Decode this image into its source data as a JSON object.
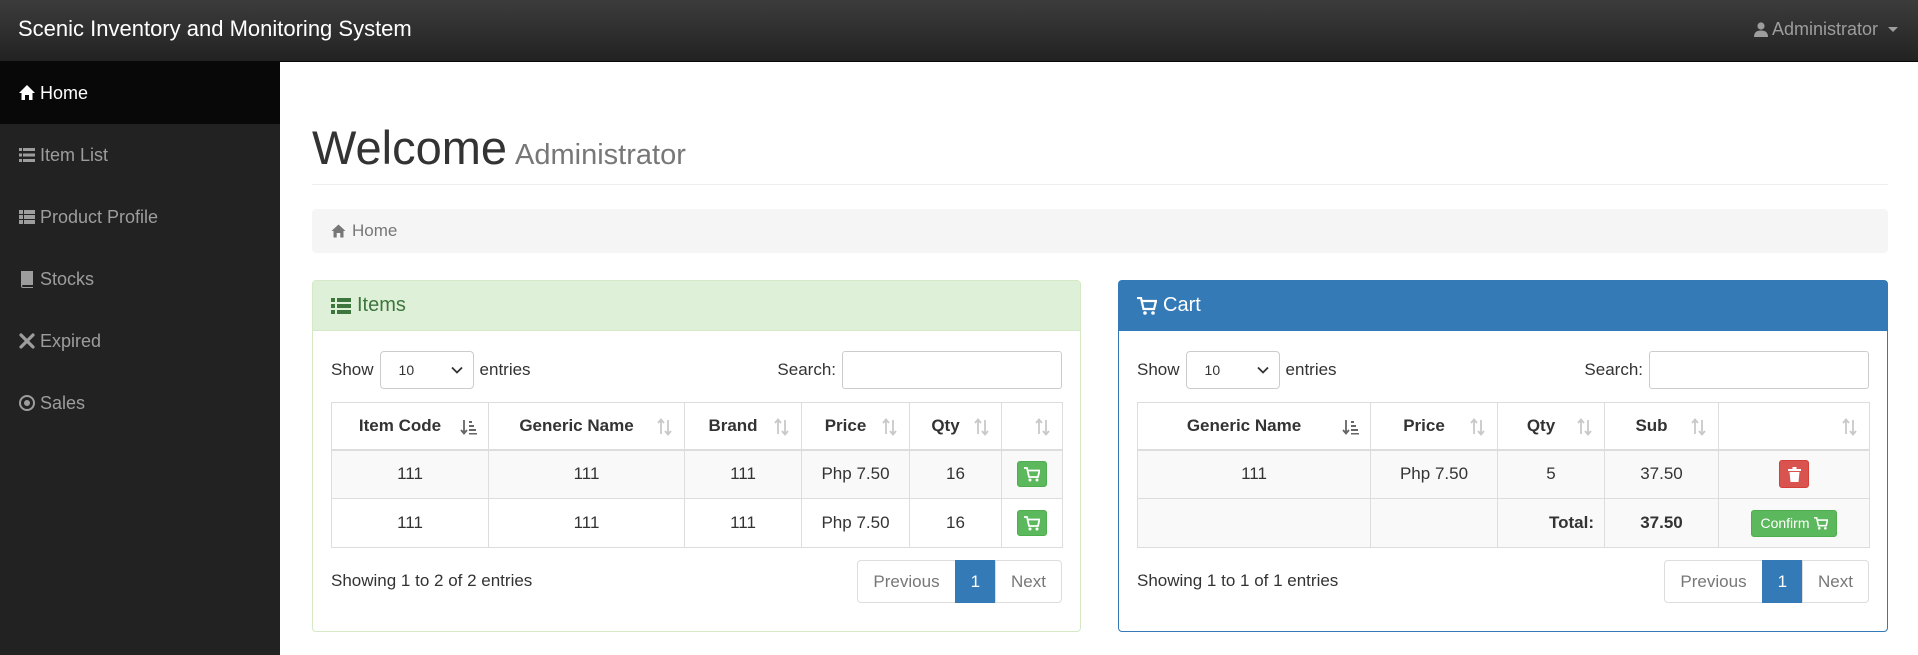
{
  "navbar": {
    "brand": "Scenic Inventory and Monitoring System",
    "user": "Administrator",
    "user_icon": "user-icon"
  },
  "sidebar": {
    "items": [
      {
        "label": "Home",
        "icon": "home-icon",
        "active": true
      },
      {
        "label": "Item List",
        "icon": "list-icon"
      },
      {
        "label": "Product Profile",
        "icon": "grid-list-icon"
      },
      {
        "label": "Stocks",
        "icon": "book-icon"
      },
      {
        "label": "Expired",
        "icon": "x-icon"
      },
      {
        "label": "Sales",
        "icon": "target-icon"
      }
    ]
  },
  "header": {
    "title": "Welcome",
    "subtitle": "Administrator"
  },
  "breadcrumb": {
    "label": "Home"
  },
  "items_panel": {
    "title": "Items",
    "show_label": "Show",
    "entries_label": "entries",
    "length_value": "10",
    "search_label": "Search:",
    "columns": [
      "Item Code",
      "Generic Name",
      "Brand",
      "Price",
      "Qty",
      ""
    ],
    "rows": [
      {
        "item_code": "111",
        "generic_name": "111",
        "brand": "111",
        "price": "Php 7.50",
        "qty": "16"
      },
      {
        "item_code": "111",
        "generic_name": "111",
        "brand": "111",
        "price": "Php 7.50",
        "qty": "16"
      }
    ],
    "info": "Showing 1 to 2 of 2 entries",
    "pager": {
      "previous": "Previous",
      "current": "1",
      "next": "Next"
    }
  },
  "cart_panel": {
    "title": "Cart",
    "show_label": "Show",
    "entries_label": "entries",
    "length_value": "10",
    "search_label": "Search:",
    "columns": [
      "Generic Name",
      "Price",
      "Qty",
      "Sub",
      ""
    ],
    "rows": [
      {
        "generic_name": "111",
        "price": "Php 7.50",
        "qty": "5",
        "sub": "37.50"
      }
    ],
    "total_label": "Total:",
    "total_value": "37.50",
    "confirm_label": "Confirm",
    "info": "Showing 1 to 1 of 1 entries",
    "pager": {
      "previous": "Previous",
      "current": "1",
      "next": "Next"
    }
  },
  "colors": {
    "primary": "#337ab7",
    "success": "#5cb85c",
    "danger": "#d9534f",
    "sidebar": "#222222"
  }
}
